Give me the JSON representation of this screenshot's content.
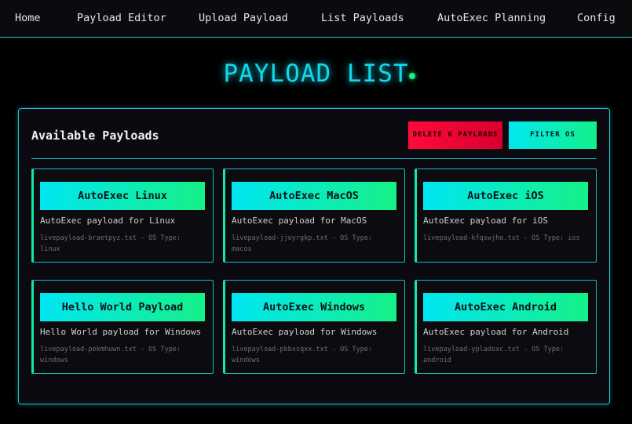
{
  "nav": {
    "items": [
      {
        "label": "Home"
      },
      {
        "label": "Payload Editor"
      },
      {
        "label": "Upload Payload"
      },
      {
        "label": "List Payloads"
      },
      {
        "label": "AutoExec Planning"
      },
      {
        "label": "Config"
      }
    ]
  },
  "page": {
    "title": "PAYLOAD LIST"
  },
  "panel": {
    "title": "Available Payloads",
    "delete_label": "DELETE 6 PAYLOADS",
    "filter_label": "FILTER OS"
  },
  "payloads": [
    {
      "name": "AutoExec Linux",
      "description": "AutoExec payload for Linux",
      "meta": "livepayload-braetpyz.txt - OS Type: linux"
    },
    {
      "name": "AutoExec MacOS",
      "description": "AutoExec payload for MacOS",
      "meta": "livepayload-jjoyrgkp.txt - OS Type: macos"
    },
    {
      "name": "AutoExec iOS",
      "description": "AutoExec payload for iOS",
      "meta": "livepayload-kfqswjho.txt - OS Type: ios"
    },
    {
      "name": "Hello World Payload",
      "description": "Hello World payload for Windows",
      "meta": "livepayload-pekmhuwn.txt - OS Type: windows"
    },
    {
      "name": "AutoExec Windows",
      "description": "AutoExec payload for Windows",
      "meta": "livepayload-pkbxsqxx.txt - OS Type: windows"
    },
    {
      "name": "AutoExec Android",
      "description": "AutoExec payload for Android",
      "meta": "livepayload-ypladoxc.txt - OS Type: android"
    }
  ],
  "colors": {
    "accent_cyan": "#12d8ec",
    "accent_green": "#16f088",
    "danger_red": "#ff0a3c",
    "background": "#000000"
  }
}
